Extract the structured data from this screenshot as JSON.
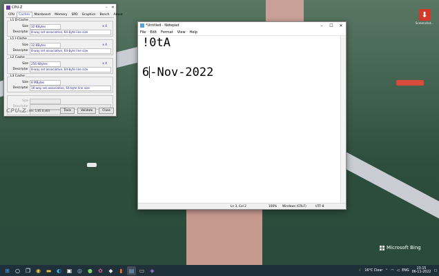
{
  "desktop": {
    "icon_label": "Screenshot...",
    "watermark": "Microsoft Bing"
  },
  "cpuz": {
    "title": "CPU-Z",
    "tabs": [
      "CPU",
      "Caches",
      "Mainboard",
      "Memory",
      "SPD",
      "Graphics",
      "Bench",
      "About"
    ],
    "active_tab": "Caches",
    "l1d": {
      "title": "L1 D-Cache",
      "size": "32 KBytes",
      "mult": "x 4",
      "desc": "8-way set associative, 64-byte line size"
    },
    "l1i": {
      "title": "L1 I-Cache",
      "size": "32 KBytes",
      "mult": "x 4",
      "desc": "8-way set associative, 64-byte line size"
    },
    "l2": {
      "title": "L2 Cache",
      "size": "256 KBytes",
      "mult": "x 4",
      "desc": "8-way set associative, 64-byte line size"
    },
    "l3": {
      "title": "L3 Cache",
      "size": "8 MBytes",
      "mult": "",
      "desc": "16-way set associative, 64-byte line size"
    },
    "labels": {
      "size": "Size",
      "descriptor": "Descriptor",
      "speed": "Speed"
    },
    "logo": "CPU-Z",
    "version": "Ver. 1.85.0.x64",
    "buttons": {
      "tools": "Tools",
      "validate": "Validate",
      "close": "Close"
    }
  },
  "notepad": {
    "title": "*Untitled - Notepad",
    "menu": [
      "File",
      "Edit",
      "Format",
      "View",
      "Help"
    ],
    "line1": "!0tA",
    "line3_before": "6",
    "line3_after": "-Nov-2022",
    "status": {
      "position": "Ln 3, Col 2",
      "zoom": "100%",
      "line_ending": "Windows (CRLF)",
      "encoding": "UTF-8"
    }
  },
  "taskbar": {
    "weather": "16°C  Clear",
    "language": "ENG",
    "time": "23:15",
    "date": "06-11-2022"
  }
}
